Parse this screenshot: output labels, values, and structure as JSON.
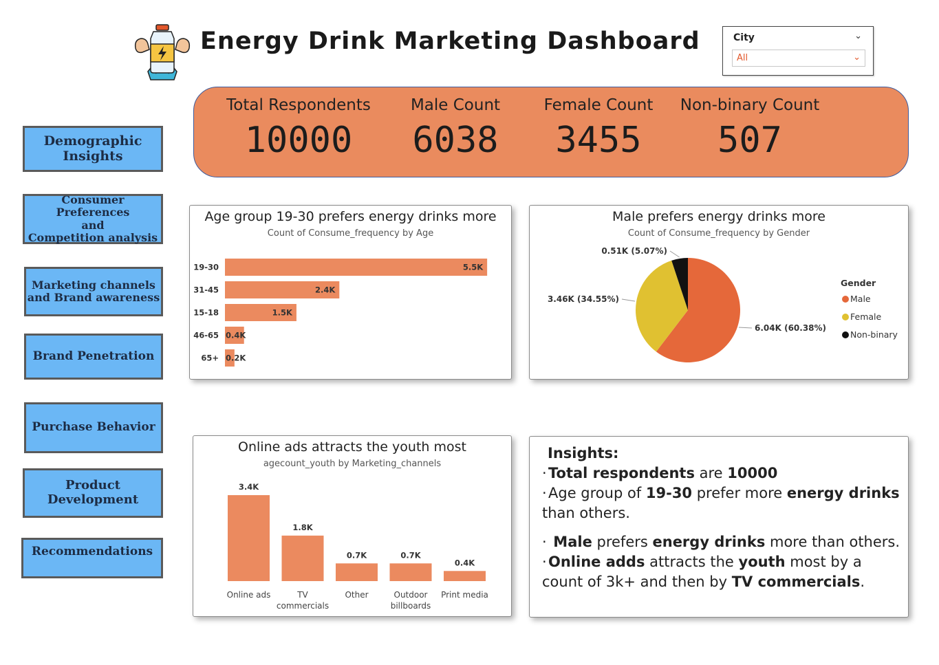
{
  "header": {
    "title": "Energy Drink Marketing Dashboard",
    "logo_icon": "energy-bottle-muscle-icon"
  },
  "filter": {
    "label": "City",
    "value": "All"
  },
  "nav": [
    {
      "label": "Demographic\nInsights"
    },
    {
      "label": "Consumer Preferences\nand\nCompetition analysis"
    },
    {
      "label": "Marketing channels\nand Brand awareness"
    },
    {
      "label": "Brand Penetration"
    },
    {
      "label": "Purchase Behavior"
    },
    {
      "label": "Product\nDevelopment"
    },
    {
      "label": "Recommendations"
    }
  ],
  "kpis": [
    {
      "label": "Total Respondents",
      "value": "10000"
    },
    {
      "label": "Male Count",
      "value": "6038"
    },
    {
      "label": "Female Count",
      "value": "3455"
    },
    {
      "label": "Non-binary Count",
      "value": "507"
    }
  ],
  "age_card": {
    "title": "Age group 19-30 prefers energy drinks more",
    "subtitle": "Count of Consume_frequency by Age"
  },
  "gender_card": {
    "title": "Male prefers energy drinks more",
    "subtitle": "Count of Consume_frequency by Gender"
  },
  "channel_card": {
    "title": "Online ads attracts the youth most",
    "subtitle": "agecount_youth by Marketing_channels"
  },
  "colors": {
    "bar": "#eb8a5f",
    "kpi_band": "#ea8b5e",
    "nav": "#6bb7f5",
    "male": "#e5683a",
    "female": "#e0c131",
    "nonbinary": "#111111"
  },
  "chart_data": [
    {
      "type": "bar",
      "orientation": "horizontal",
      "categories": [
        "19-30",
        "31-45",
        "15-18",
        "46-65",
        "65+"
      ],
      "values": [
        5.5,
        2.4,
        1.5,
        0.4,
        0.2
      ],
      "value_labels": [
        "5.5K",
        "2.4K",
        "1.5K",
        "0.4K",
        "0.2K"
      ],
      "xlim": [
        0,
        5.7
      ]
    },
    {
      "type": "pie",
      "legend_title": "Gender",
      "legend_position": "right",
      "slices": [
        {
          "name": "Male",
          "value": 60.38,
          "label": "6.04K (60.38%)"
        },
        {
          "name": "Female",
          "value": 34.55,
          "label": "3.46K (34.55%)"
        },
        {
          "name": "Non-binary",
          "value": 5.07,
          "label": "0.51K (5.07%)"
        }
      ]
    },
    {
      "type": "bar",
      "orientation": "vertical",
      "categories": [
        "Online ads",
        "TV\ncommercials",
        "Other",
        "Outdoor\nbillboards",
        "Print media"
      ],
      "values": [
        3.4,
        1.8,
        0.7,
        0.7,
        0.4
      ],
      "value_labels": [
        "3.4K",
        "1.8K",
        "0.7K",
        "0.7K",
        "0.4K"
      ],
      "ylim": [
        0,
        3.4
      ]
    }
  ],
  "insights": {
    "title": "Insights:",
    "items": [
      [
        {
          "t": "Total respondents",
          "b": true
        },
        {
          "t": " are ",
          "b": false
        },
        {
          "t": "10000",
          "b": true
        }
      ],
      [
        {
          "t": "Age group of ",
          "b": false
        },
        {
          "t": "19-30",
          "b": true
        },
        {
          "t": " prefer more ",
          "b": false
        },
        {
          "t": "energy drinks",
          "b": true
        },
        {
          "t": " than others.",
          "b": false
        }
      ],
      [
        {
          "t": " Male",
          "b": true
        },
        {
          "t": " prefers ",
          "b": false
        },
        {
          "t": "energy drinks",
          "b": true
        },
        {
          "t": " more than others.",
          "b": false
        }
      ],
      [
        {
          "t": "Online adds",
          "b": true
        },
        {
          "t": " attracts the ",
          "b": false
        },
        {
          "t": "youth",
          "b": true
        },
        {
          "t": " most by a count of 3k+ and then by ",
          "b": false
        },
        {
          "t": "TV commercials",
          "b": true
        },
        {
          "t": ".",
          "b": false
        }
      ]
    ]
  }
}
